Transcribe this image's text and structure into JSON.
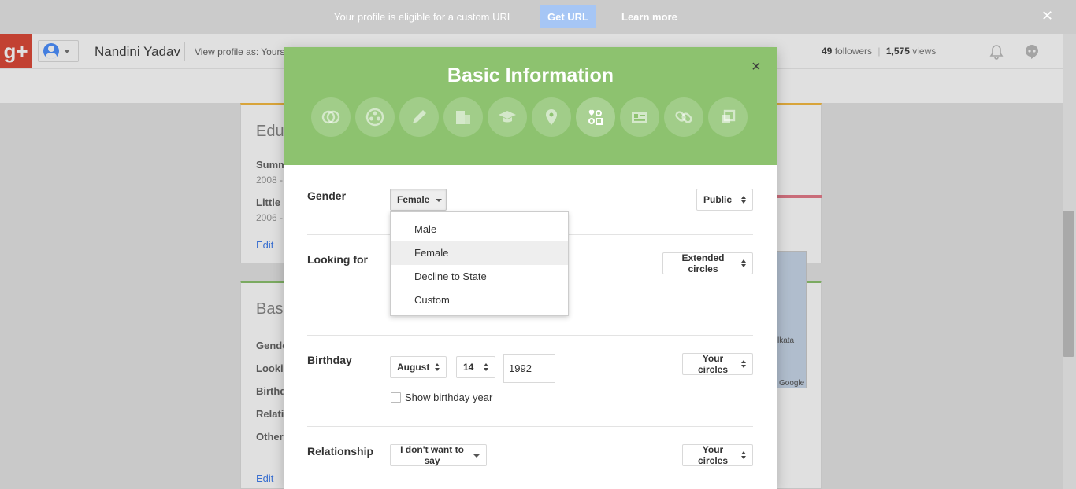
{
  "notification": {
    "text": "Your profile is eligible for a custom URL",
    "get_url_label": "Get URL",
    "learn_more_label": "Learn more",
    "close_glyph": "✕"
  },
  "header": {
    "logo_text": "g+",
    "profile_name": "Nandini Yadav",
    "view_as": "View profile as: Yours",
    "followers_count": "49",
    "followers_label": "followers",
    "separator": "|",
    "views_count": "1,575",
    "views_label": "views"
  },
  "background_cards": {
    "education": {
      "title": "Educ",
      "item1_name": "Summ",
      "item1_dates": "2008 -",
      "item2_name": "Little",
      "item2_dates": "2006 -",
      "edit_label": "Edit"
    },
    "basic": {
      "title": "Basi",
      "rows": [
        "Gende",
        "Lookin",
        "Birthd",
        "Relatio",
        "Other"
      ],
      "edit_label": "Edit"
    },
    "map": {
      "city_label": "lkata",
      "attribution": "Google"
    }
  },
  "dialog": {
    "title": "Basic Information",
    "close_glyph": "×",
    "category_icons": [
      "circles-icon",
      "photos-icon",
      "story-icon",
      "work-icon",
      "education-icon",
      "places-icon",
      "basic-info-icon",
      "contact-info-icon",
      "links-icon",
      "other-profiles-icon"
    ],
    "gender": {
      "label": "Gender",
      "value": "Female",
      "visibility": "Public",
      "options": [
        "Male",
        "Female",
        "Decline to State",
        "Custom"
      ],
      "selected_index": 1
    },
    "looking_for": {
      "label": "Looking for",
      "visibility": "Extended circles"
    },
    "birthday": {
      "label": "Birthday",
      "month": "August",
      "day": "14",
      "year": "1992",
      "show_year_label": "Show birthday year",
      "show_year_checked": false,
      "visibility": "Your circles"
    },
    "relationship": {
      "label": "Relationship",
      "value": "I don't want to say",
      "visibility": "Your circles"
    }
  },
  "colors": {
    "dialog_header": "#8dc26f",
    "notification_bar": "#cbcbcb",
    "get_url_button": "#a6c6f5",
    "gplus_red": "#dd4b39"
  }
}
